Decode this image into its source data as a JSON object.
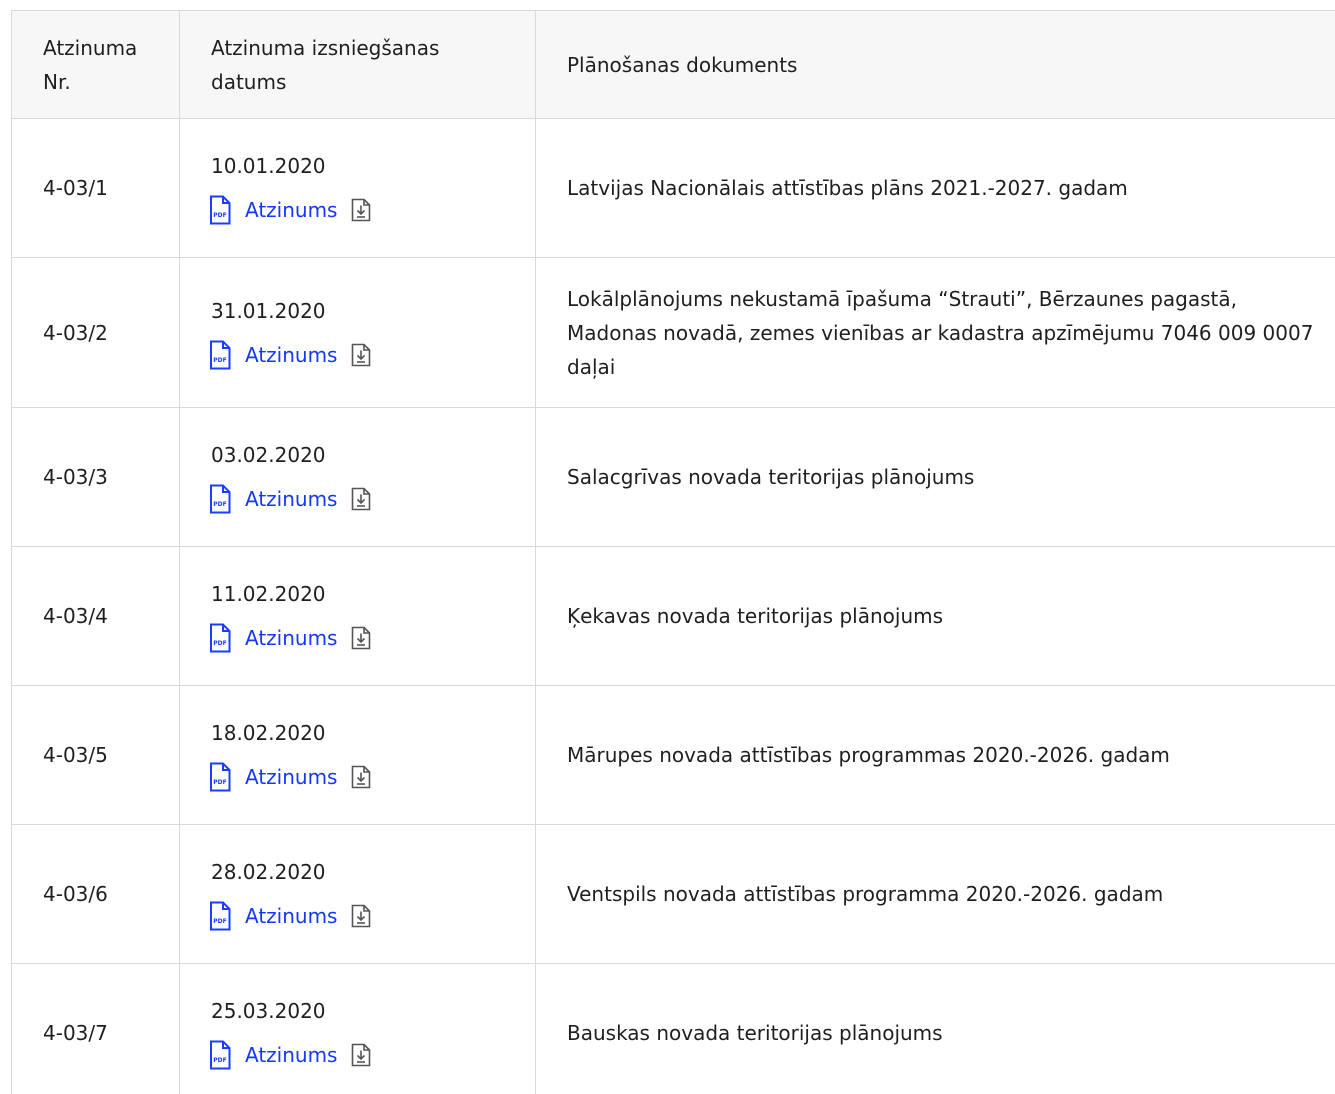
{
  "table": {
    "headers": {
      "number": "Atzinuma Nr.",
      "date": "Atzinuma izsniegšanas datums",
      "document": "Plānošanas dokuments"
    },
    "link_label": "Atzinums",
    "pdf_icon_text": "PDF",
    "rows": [
      {
        "number": "4-03/1",
        "date": "10.01.2020",
        "document": "Latvijas Nacionālais attīstības plāns 2021.-2027. gadam"
      },
      {
        "number": "4-03/2",
        "date": "31.01.2020",
        "document": "Lokālplānojums nekustamā īpašuma “Strauti”, Bērzaunes pagastā, Madonas novadā, zemes vienības ar kadastra apzīmējumu 7046 009 0007 daļai"
      },
      {
        "number": "4-03/3",
        "date": "03.02.2020",
        "document": "Salacgrīvas novada teritorijas plānojums"
      },
      {
        "number": "4-03/4",
        "date": "11.02.2020",
        "document": "Ķekavas novada teritorijas plānojums"
      },
      {
        "number": "4-03/5",
        "date": "18.02.2020",
        "document": "Mārupes novada attīstības programmas 2020.-2026. gadam"
      },
      {
        "number": "4-03/6",
        "date": "28.02.2020",
        "document": "Ventspils novada attīstības programma 2020.-2026. gadam"
      },
      {
        "number": "4-03/7",
        "date": "25.03.2020",
        "document": "Bauskas novada teritorijas plānojums"
      }
    ]
  },
  "colors": {
    "link": "#1438f5",
    "border": "#d9d9d9",
    "header_bg": "#f7f7f7",
    "icon_blue": "#1a3dff",
    "icon_grey": "#555555"
  },
  "icons": {
    "file": "pdf-file-icon",
    "download": "download-icon"
  }
}
